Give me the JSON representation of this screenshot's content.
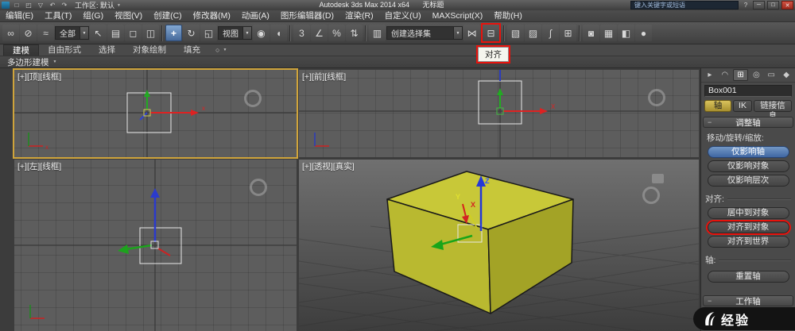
{
  "titlebar": {
    "workspace_label": "工作区: 默认",
    "app_title": "Autodesk 3ds Max  2014 x64",
    "doc_title": "无标题",
    "search_placeholder": "键入关键字或短语"
  },
  "menubar": {
    "items": [
      "编辑(E)",
      "工具(T)",
      "组(G)",
      "视图(V)",
      "创建(C)",
      "修改器(M)",
      "动画(A)",
      "图形编辑器(D)",
      "渲染(R)",
      "自定义(U)",
      "MAXScript(X)",
      "帮助(H)"
    ]
  },
  "toolbar": {
    "filter_value": "全部",
    "coord_value": "视图",
    "selection_set_value": "创建选择集",
    "align_tooltip": "对齐"
  },
  "ribbon": {
    "tabs": [
      "建模",
      "自由形式",
      "选择",
      "对象绘制",
      "填充"
    ],
    "subtab": "多边形建模"
  },
  "viewports": {
    "top": {
      "label": "[+][顶][线框]",
      "axis_label": "x"
    },
    "front": {
      "label": "[+][前][线框]",
      "axis_label": "X"
    },
    "left": {
      "label": "[+][左][线框]"
    },
    "persp": {
      "label": "[+][透视][真实]",
      "axis_x": "X",
      "axis_y": "Y",
      "axis_z": "Z"
    }
  },
  "command_panel": {
    "object_name": "Box001",
    "tabs": [
      "轴",
      "IK",
      "链接信息"
    ],
    "rollout_adjust": "调整轴",
    "rollout_work": "工作轴",
    "label_move": "移动/旋转/缩放:",
    "label_align": "对齐:",
    "label_axis": "轴:",
    "btn_affect_pivot": "仅影响轴",
    "btn_affect_object": "仅影响对象",
    "btn_affect_hierarchy": "仅影响层次",
    "btn_center_to_object": "居中到对象",
    "btn_align_to_object": "对齐到对象",
    "btn_align_to_world": "对齐到世界",
    "btn_reset_pivot": "重置轴"
  },
  "watermark": {
    "text": "经验"
  },
  "icons": {
    "caret_down": "▼",
    "minimize": "─",
    "maximize": "□",
    "close": "✕",
    "help": "?",
    "qat_new": "□",
    "qat_open": "◰",
    "qat_save": "▽",
    "qat_undo": "↶",
    "qat_redo": "↷",
    "select_link": "∞",
    "break_link": "⊘",
    "bind_spacewarp": "≈",
    "select_object": "↖",
    "select_by_name": "▤",
    "selection_region": "◻",
    "window_crossing": "◫",
    "select_move": "+",
    "select_rotate": "↻",
    "select_scale": "◱",
    "use_pivot": "◉",
    "select_manipulate": "◖",
    "snap_toggle": "3",
    "angle_snap": "∠",
    "percent_snap": "%",
    "spinner_snap": "⇅",
    "edit_named_sets": "▥",
    "mirror": "⋈",
    "align": "⊟",
    "layer_manager": "▧",
    "ribbon_toggle": "▨",
    "curve_editor": "∫",
    "schematic_view": "⊞",
    "material_editor": "◙",
    "render_setup": "▦",
    "rendered_frame": "◧",
    "render_production": "●",
    "tab_create": "▸",
    "tab_modify": "◠",
    "tab_hierarchy": "⊞",
    "tab_motion": "◎",
    "tab_display": "▭",
    "tab_utilities": "◆",
    "ribbon_sphere": "○",
    "rollout_collapse": "−"
  },
  "colors": {
    "box_top": "#c8c838",
    "box_left": "#b9b930",
    "box_right": "#a3a326",
    "annotation_red": "#e8120c",
    "active_viewport_border": "#cfa43b",
    "active_tool_blue": "#4f7cb0"
  }
}
